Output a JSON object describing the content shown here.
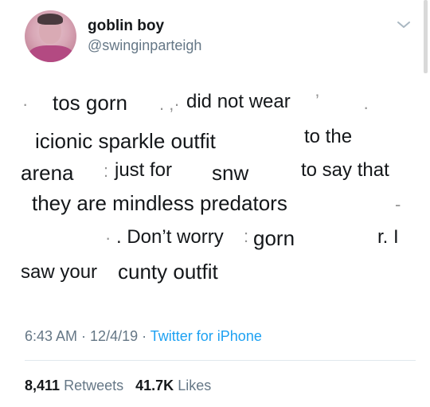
{
  "user": {
    "display_name": "goblin boy",
    "handle": "@swinginparteigh"
  },
  "icons": {
    "menu": "chevron-down-icon"
  },
  "tweet": {
    "lines": [
      {
        "segments": [
          "tos gorn",
          "did not wear"
        ]
      },
      {
        "segments": [
          "icionic sparkle outfit",
          "to the"
        ]
      },
      {
        "segments": [
          "arena",
          "just for",
          "snw",
          "to say that"
        ]
      },
      {
        "segments": [
          "they are mindless predators"
        ]
      },
      {
        "segments": [
          ". Don’t worry",
          "gorn",
          "r. I"
        ]
      },
      {
        "segments": [
          "saw your",
          "cunty outfit"
        ]
      }
    ]
  },
  "meta": {
    "time": "6:43 AM",
    "separator": " · ",
    "date": "12/4/19",
    "source": "Twitter for iPhone"
  },
  "stats": {
    "retweets_count": "8,411",
    "retweets_label": "Retweets",
    "likes_count": "41.7K",
    "likes_label": "Likes"
  },
  "colors": {
    "text": "#14171a",
    "secondary": "#657786",
    "link": "#1da1f2",
    "divider": "#e1e8ed"
  }
}
